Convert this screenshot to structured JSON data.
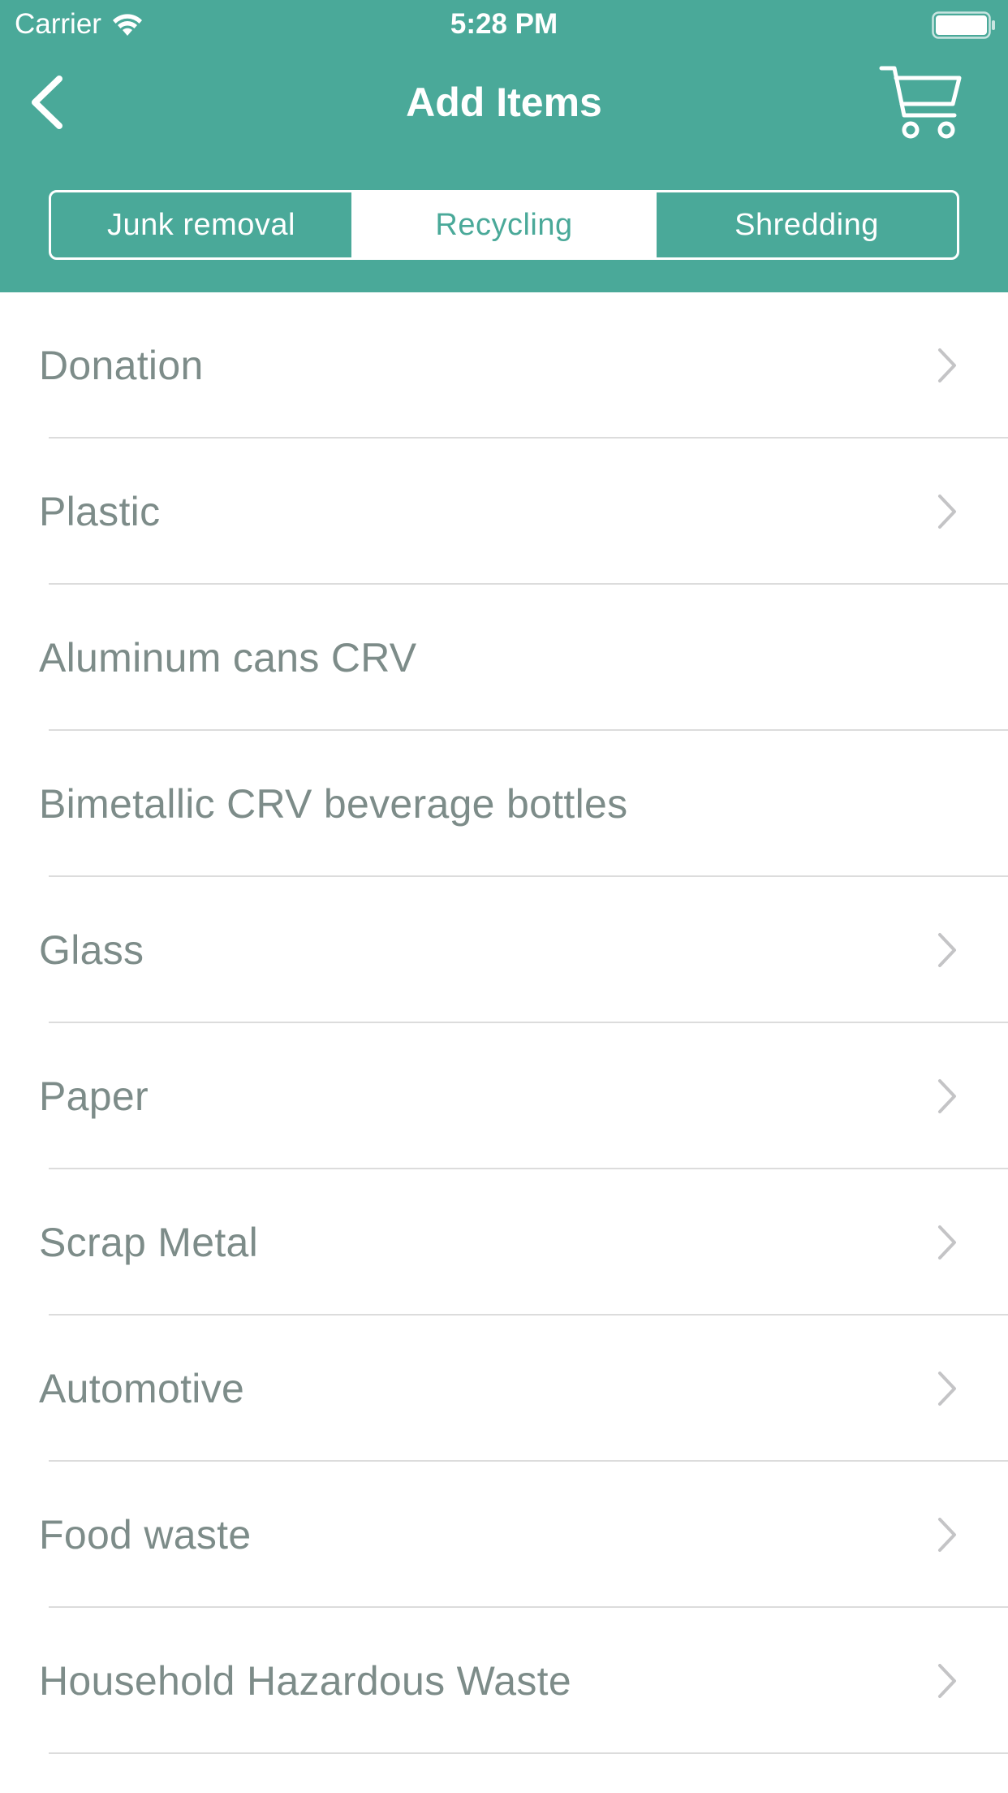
{
  "status_bar": {
    "carrier": "Carrier",
    "time": "5:28 PM"
  },
  "nav": {
    "title": "Add Items",
    "back_icon": "chevron-left-icon",
    "cart_icon": "cart-icon"
  },
  "segments": [
    {
      "label": "Junk removal",
      "active": false
    },
    {
      "label": "Recycling",
      "active": true
    },
    {
      "label": "Shredding",
      "active": false
    }
  ],
  "items": [
    {
      "label": "Donation",
      "chevron": true
    },
    {
      "label": "Plastic",
      "chevron": true
    },
    {
      "label": "Aluminum cans CRV",
      "chevron": false
    },
    {
      "label": "Bimetallic CRV beverage bottles",
      "chevron": false
    },
    {
      "label": "Glass",
      "chevron": true
    },
    {
      "label": "Paper",
      "chevron": true
    },
    {
      "label": "Scrap Metal",
      "chevron": true
    },
    {
      "label": "Automotive",
      "chevron": true
    },
    {
      "label": "Food waste",
      "chevron": true
    },
    {
      "label": "Household Hazardous Waste",
      "chevron": true
    }
  ],
  "colors": {
    "accent": "#4aa999",
    "text": "#7d8c89",
    "separator": "#dcdcdc",
    "chevron": "#c4c4c6"
  }
}
